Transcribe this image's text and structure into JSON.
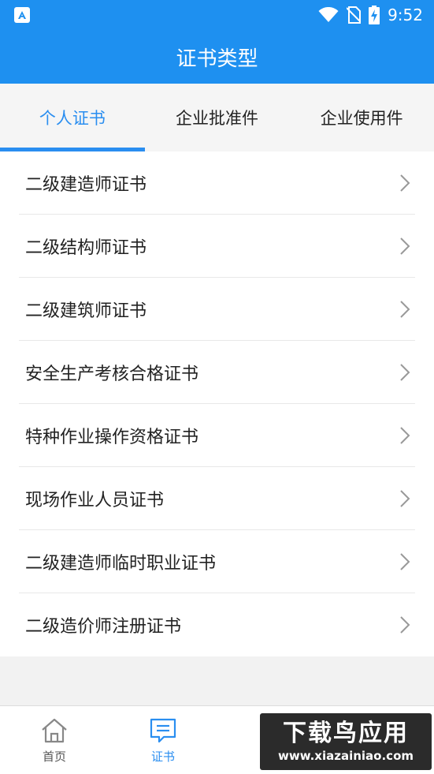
{
  "status_bar": {
    "time": "9:52",
    "icons": [
      "app-badge-icon",
      "wifi-icon",
      "no-sim-icon",
      "battery-charging-icon"
    ]
  },
  "header": {
    "title": "证书类型"
  },
  "tabs": [
    {
      "label": "个人证书",
      "active": true
    },
    {
      "label": "企业批准件",
      "active": false
    },
    {
      "label": "企业使用件",
      "active": false
    }
  ],
  "certificates": [
    {
      "label": "二级建造师证书"
    },
    {
      "label": "二级结构师证书"
    },
    {
      "label": "二级建筑师证书"
    },
    {
      "label": "安全生产考核合格证书"
    },
    {
      "label": "特种作业操作资格证书"
    },
    {
      "label": "现场作业人员证书"
    },
    {
      "label": "二级建造师临时职业证书"
    },
    {
      "label": "二级造价师注册证书"
    }
  ],
  "bottom_nav": [
    {
      "label": "首页",
      "icon": "home-icon",
      "active": false
    },
    {
      "label": "证书",
      "icon": "certificate-icon",
      "active": true
    }
  ],
  "watermark": {
    "main": "下载鸟应用",
    "sub": "www.xiazainiao.com"
  },
  "colors": {
    "primary": "#1e90f0",
    "accent": "#2a8ef0",
    "text": "#222222",
    "background": "#f2f2f2"
  }
}
